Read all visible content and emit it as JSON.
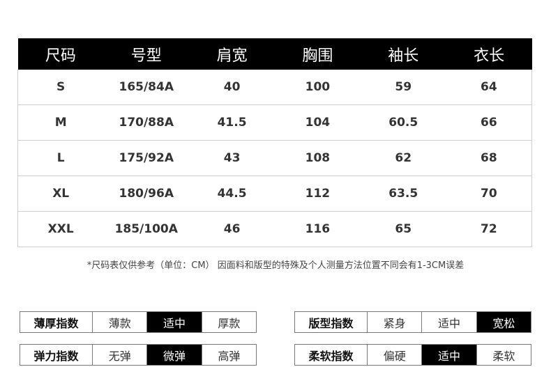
{
  "size_table": {
    "headers": [
      "尺码",
      "号型",
      "肩宽",
      "胸围",
      "袖长",
      "衣长"
    ],
    "rows": [
      [
        "S",
        "165/84A",
        "40",
        "100",
        "59",
        "64"
      ],
      [
        "M",
        "170/88A",
        "41.5",
        "104",
        "60.5",
        "66"
      ],
      [
        "L",
        "175/92A",
        "43",
        "108",
        "62",
        "68"
      ],
      [
        "XL",
        "180/96A",
        "44.5",
        "112",
        "63.5",
        "70"
      ],
      [
        "XXL",
        "185/100A",
        "46",
        "116",
        "65",
        "72"
      ]
    ]
  },
  "note": "*尺码表仅供参考（单位：CM） 因面料和版型的特殊及个人测量方法位置不同会有1-3CM误差",
  "indices": {
    "thickness": {
      "label": "薄厚指数",
      "options": [
        "薄款",
        "适中",
        "厚款"
      ],
      "selected": 1
    },
    "fit": {
      "label": "版型指数",
      "options": [
        "紧身",
        "适中",
        "宽松"
      ],
      "selected": 2
    },
    "elastic": {
      "label": "弹力指数",
      "options": [
        "无弹",
        "微弹",
        "高弹"
      ],
      "selected": 1
    },
    "softness": {
      "label": "柔软指数",
      "options": [
        "偏硬",
        "适中",
        "柔软"
      ],
      "selected": 1
    }
  },
  "colors": {
    "header_bg": "#000000",
    "header_text": "#ffffff",
    "selected_bg": "#000000"
  }
}
